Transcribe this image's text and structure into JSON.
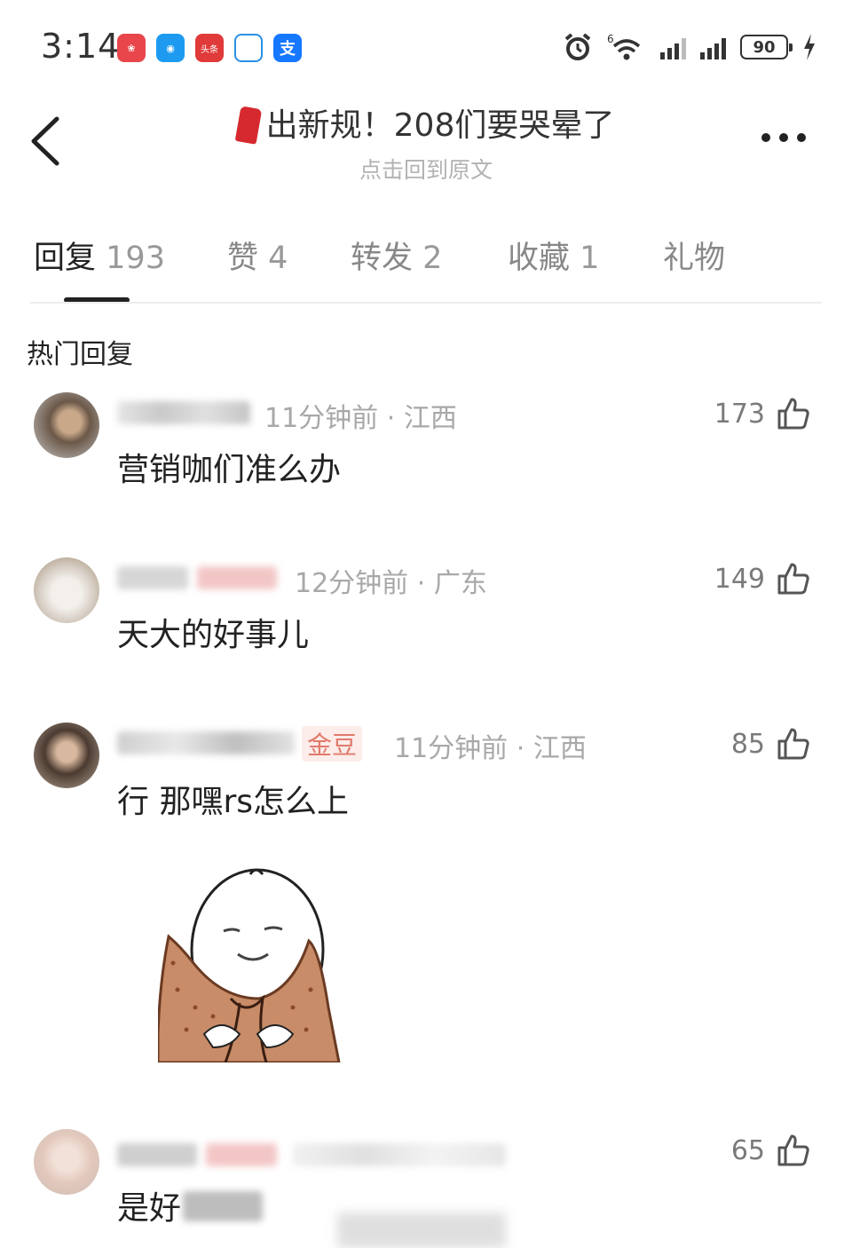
{
  "status_bar": {
    "time": "3:14",
    "app_icons": [
      "app-icon-red",
      "message-icon",
      "toutiao-icon",
      "tmall-icon",
      "alipay-icon"
    ],
    "toutiao_label": "头条",
    "alipay_label": "支",
    "network_label": "6",
    "battery": "90"
  },
  "header": {
    "title": "出新规！208们要哭晕了",
    "subtitle": "点击回到原文"
  },
  "tabs": [
    {
      "label": "回复",
      "count": "193"
    },
    {
      "label": "赞",
      "count": "4"
    },
    {
      "label": "转发",
      "count": "2"
    },
    {
      "label": "收藏",
      "count": "1"
    },
    {
      "label": "礼物",
      "count": ""
    }
  ],
  "section_title": "热门回复",
  "comments": [
    {
      "time": "11分钟前",
      "region": "江西",
      "separator": "·",
      "likes": "173",
      "text": "营销咖们准么办"
    },
    {
      "time": "12分钟前",
      "region": "广东",
      "separator": "·",
      "likes": "149",
      "text": "天大的好事儿"
    },
    {
      "time": "11分钟前",
      "region": "江西",
      "separator": "·",
      "likes": "85",
      "text": "行 那嘿rs怎么上",
      "medal": "金豆"
    },
    {
      "likes": "65",
      "text": "是好"
    }
  ],
  "colors": {
    "accent_text": "#222222",
    "muted_text": "#a8a8a8",
    "scarf_red": "#d6282f"
  }
}
